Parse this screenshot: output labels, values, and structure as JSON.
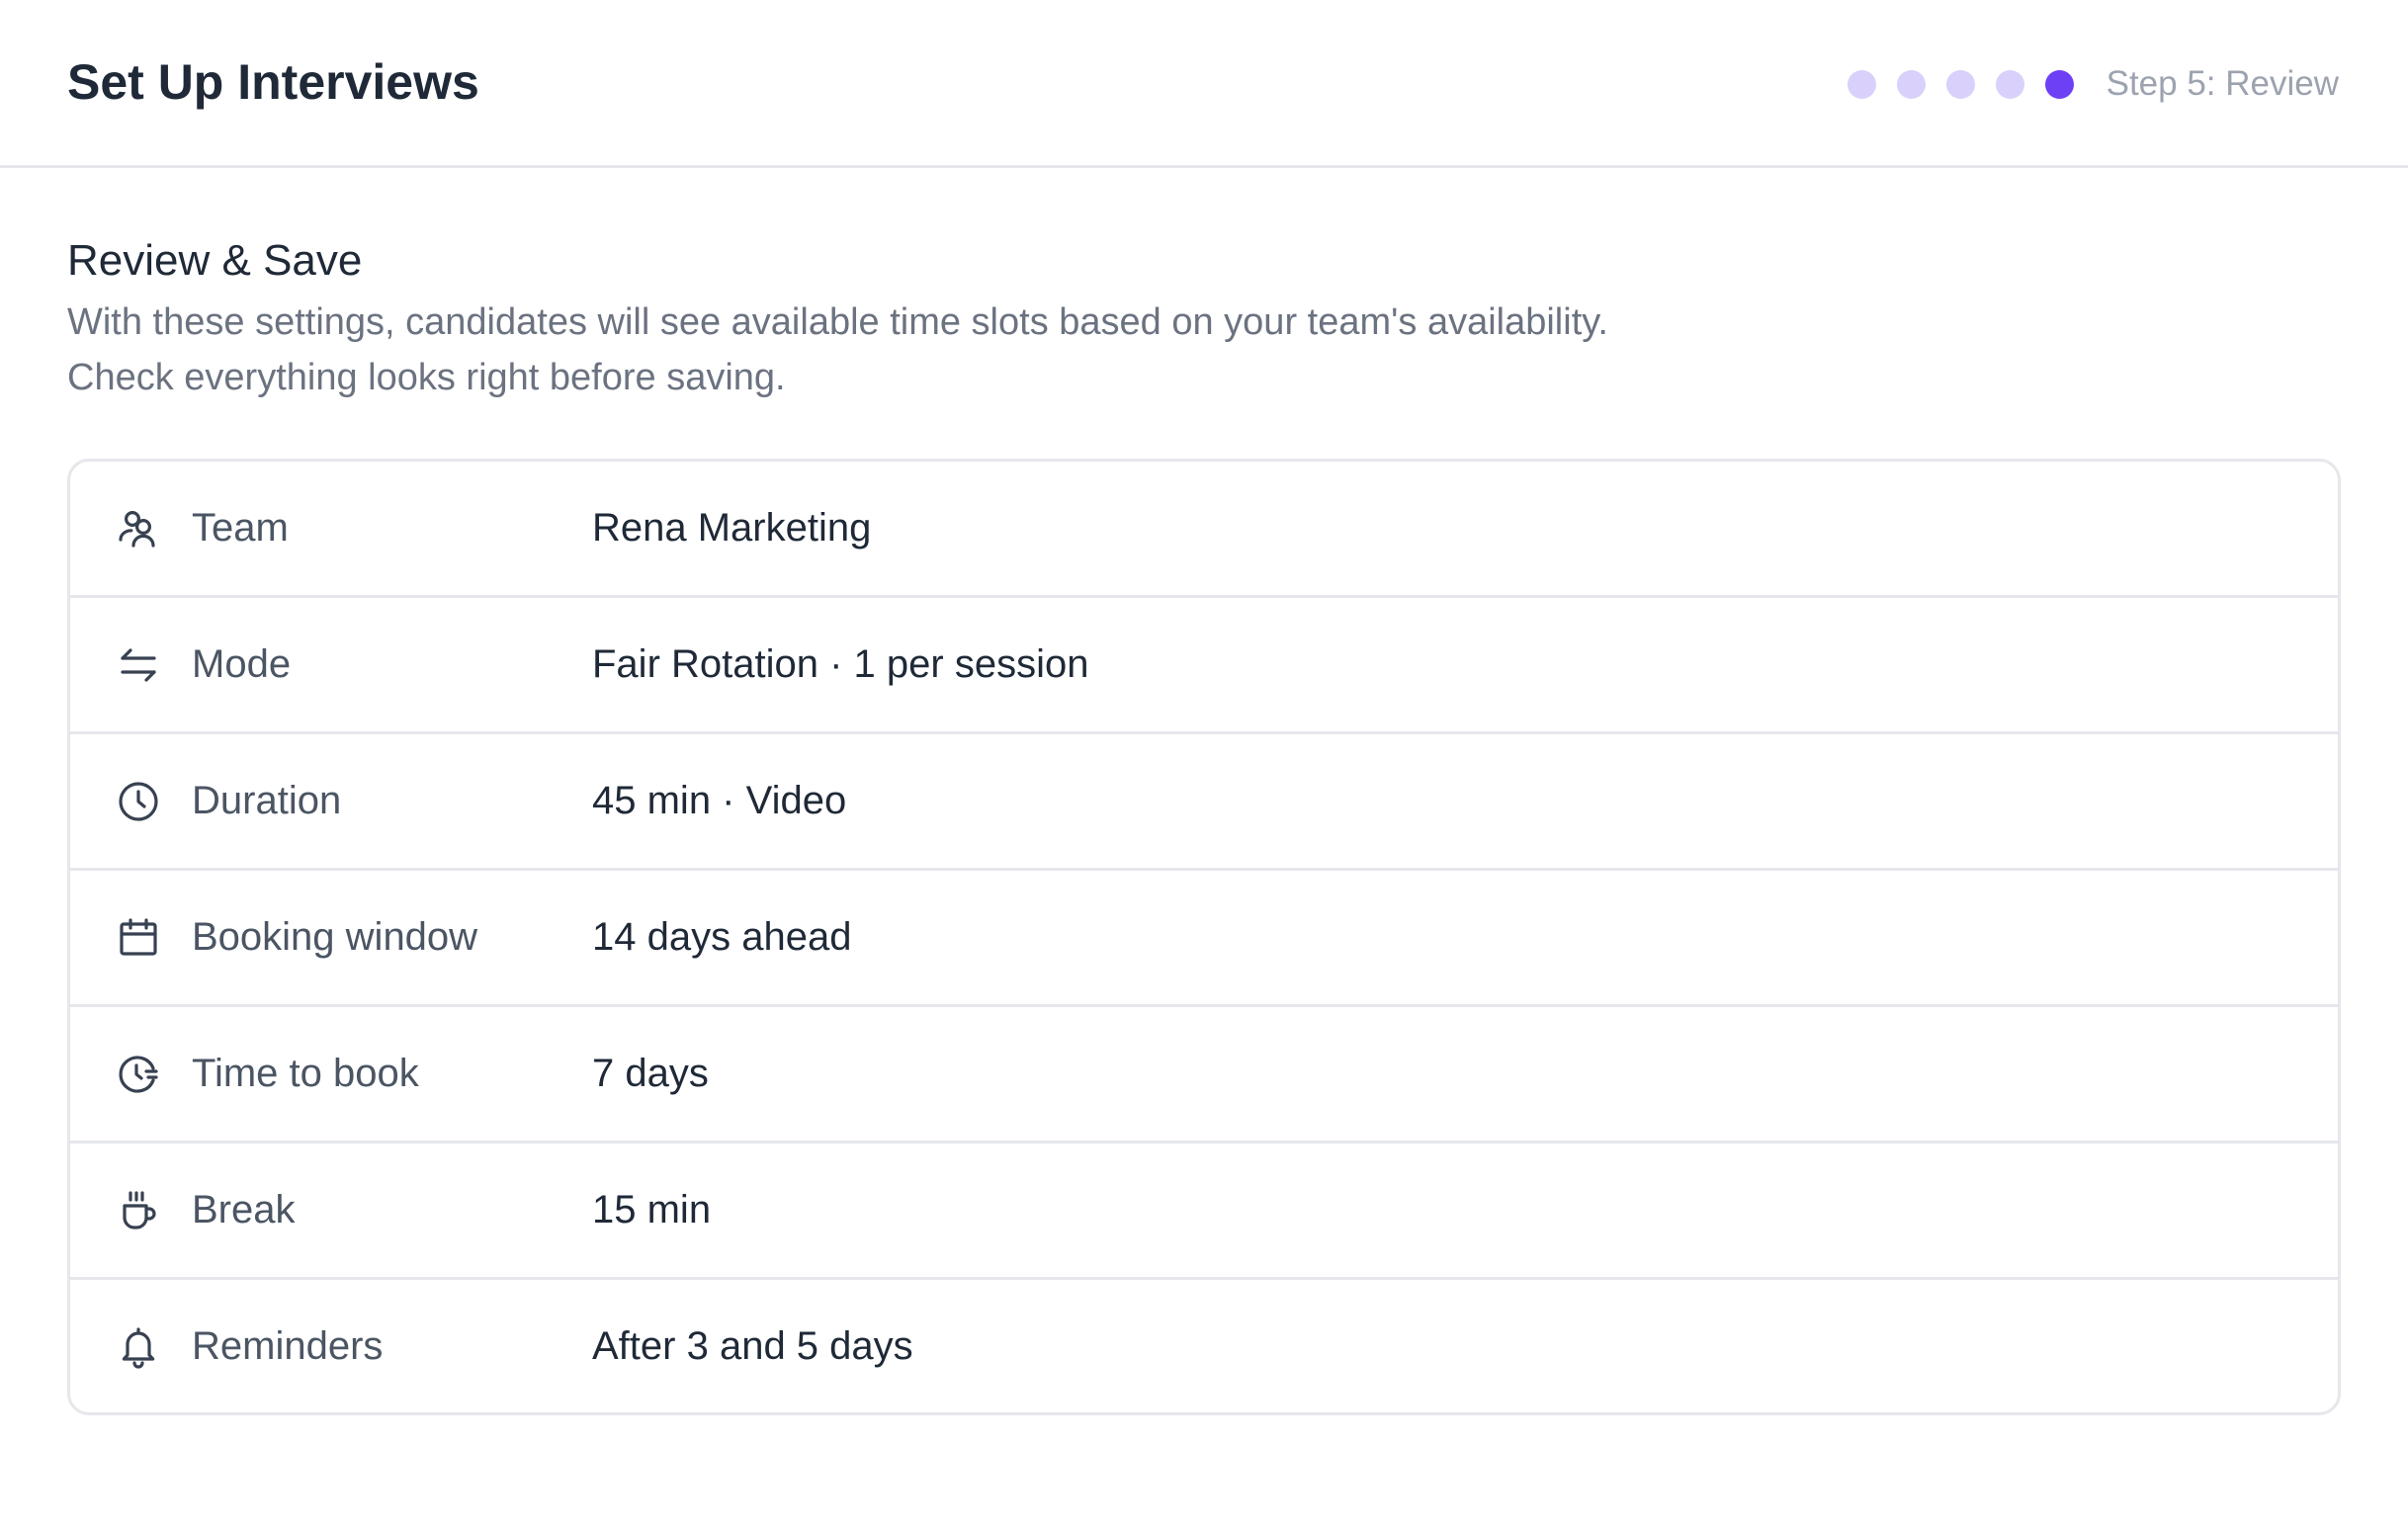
{
  "header": {
    "title": "Set Up Interviews",
    "step_label": "Step 5: Review",
    "steps": [
      {
        "active": false
      },
      {
        "active": false
      },
      {
        "active": false
      },
      {
        "active": false
      },
      {
        "active": true
      }
    ]
  },
  "section": {
    "title": "Review & Save",
    "description_line1": "With these settings, candidates will see available time slots based on your team's availability.",
    "description_line2": "Check everything looks right before saving."
  },
  "summary": {
    "rows": [
      {
        "icon": "team-icon",
        "label": "Team",
        "value": "Rena Marketing"
      },
      {
        "icon": "swap-arrows-icon",
        "label": "Mode",
        "value": "Fair Rotation · 1 per session"
      },
      {
        "icon": "clock-icon",
        "label": "Duration",
        "value": "45 min · Video"
      },
      {
        "icon": "calendar-icon",
        "label": "Booking window",
        "value": "14 days ahead"
      },
      {
        "icon": "fast-clock-icon",
        "label": "Time to book",
        "value": "7 days"
      },
      {
        "icon": "coffee-cup-icon",
        "label": "Break",
        "value": "15 min"
      },
      {
        "icon": "bell-icon",
        "label": "Reminders",
        "value": "After 3 and 5 days"
      }
    ]
  },
  "colors": {
    "accent": "#6d3ff5",
    "accent_light": "#d9d0fb",
    "border": "#e5e7eb",
    "text_primary": "#1f2937",
    "text_secondary": "#6b7280"
  }
}
